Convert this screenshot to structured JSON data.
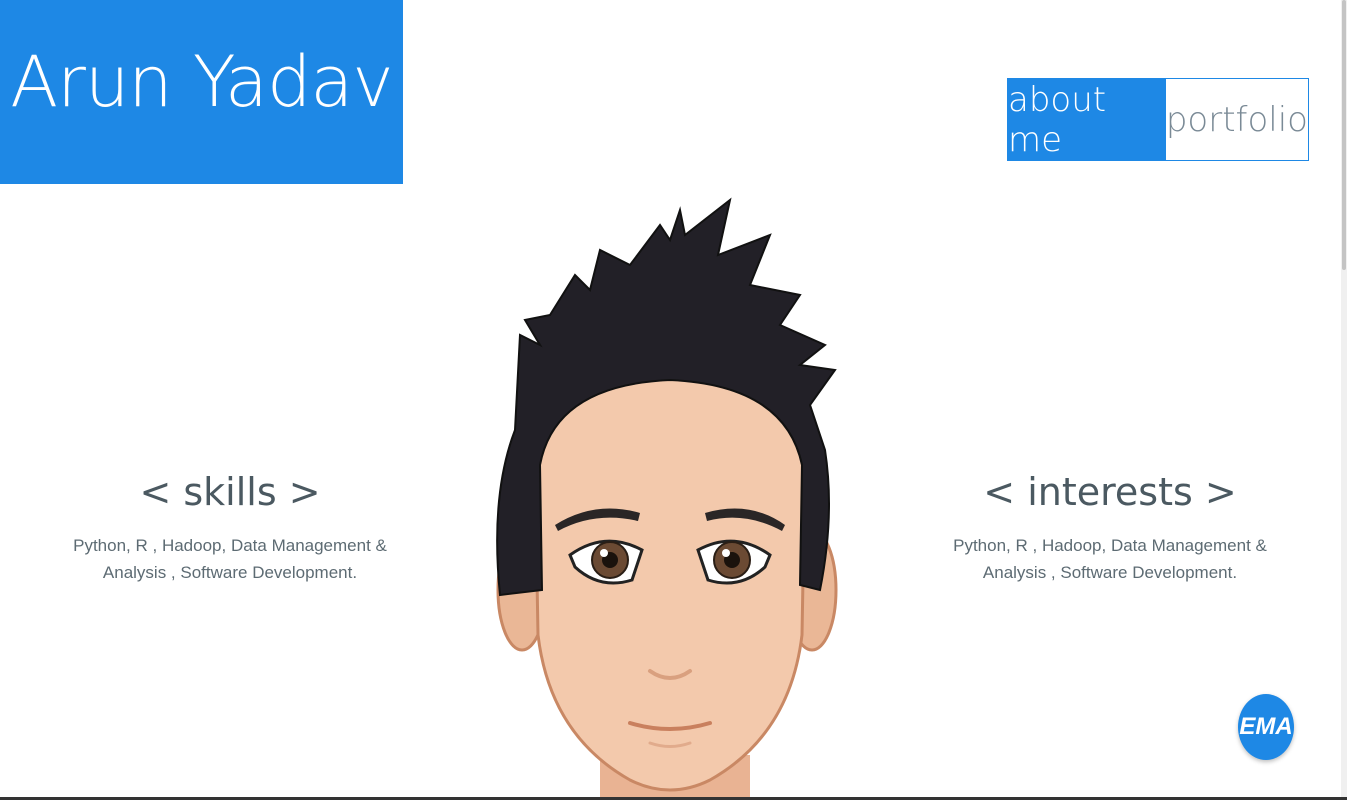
{
  "brand": {
    "name": "Arun Yadav"
  },
  "nav": {
    "about": "about me",
    "portfolio": "portfolio"
  },
  "skills": {
    "title": "< skills >",
    "text": "Python, R , Hadoop, Data Management & Analysis , Software Development."
  },
  "interests": {
    "title": "< interests >",
    "text": "Python, R , Hadoop, Data Management & Analysis , Software Development."
  },
  "email_button": {
    "label": "EMA"
  },
  "colors": {
    "accent": "#1e88e5",
    "text": "#5d6b73"
  },
  "icons": {
    "avatar": "cartoon-avatar-illustration"
  }
}
